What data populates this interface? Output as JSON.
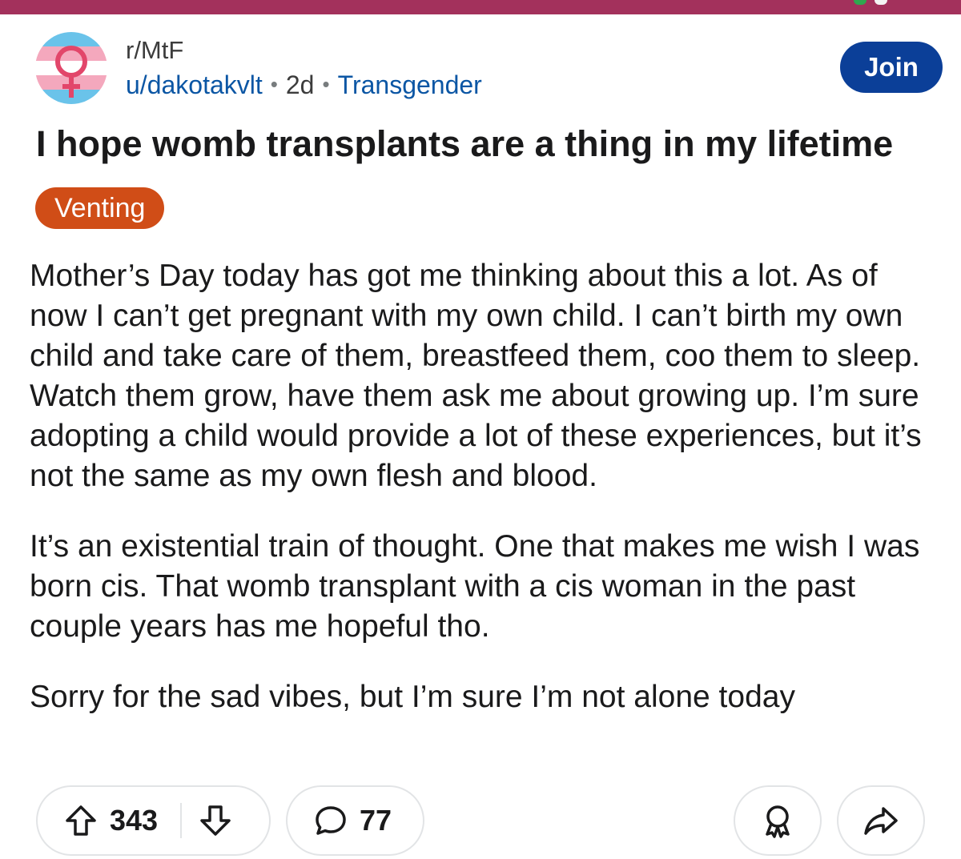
{
  "post": {
    "subreddit": "r/MtF",
    "author": "u/dakotakvlt",
    "separator": "•",
    "age": "2d",
    "topic": "Transgender",
    "title": "I hope womb transplants are a thing in my lifetime",
    "flair": "Venting",
    "body": [
      "Mother’s Day today has got me thinking about this a lot. As of now I can’t get pregnant with my own child. I can’t birth my own child and take care of them, breastfeed them, coo them to sleep. Watch them grow, have them ask me about growing up. I’m sure adopting a child would provide a lot of these experiences, but it’s not the same as my own flesh and blood.",
      "It’s an existential train of thought. One that makes me wish I was born cis. That womb transplant with a cis woman in the past couple years has me hopeful tho.",
      "Sorry for the sad vibes, but I’m sure I’m not alone today"
    ]
  },
  "actions": {
    "join_label": "Join",
    "upvotes": "343",
    "comments": "77"
  },
  "icons": {
    "avatar": "trans-flag-venus-icon",
    "upvote": "arrow-up-icon",
    "downvote": "arrow-down-icon",
    "comment": "speech-bubble-icon",
    "award": "award-icon",
    "share": "share-arrow-icon"
  },
  "colors": {
    "top_bar": "#a3315c",
    "join_button": "#0b3f98",
    "link_blue": "#0b56a4",
    "flair": "#d04d17",
    "trans_blue": "#6ac3ea",
    "trans_pink": "#f4a8bd",
    "venus": "#e2466a"
  }
}
